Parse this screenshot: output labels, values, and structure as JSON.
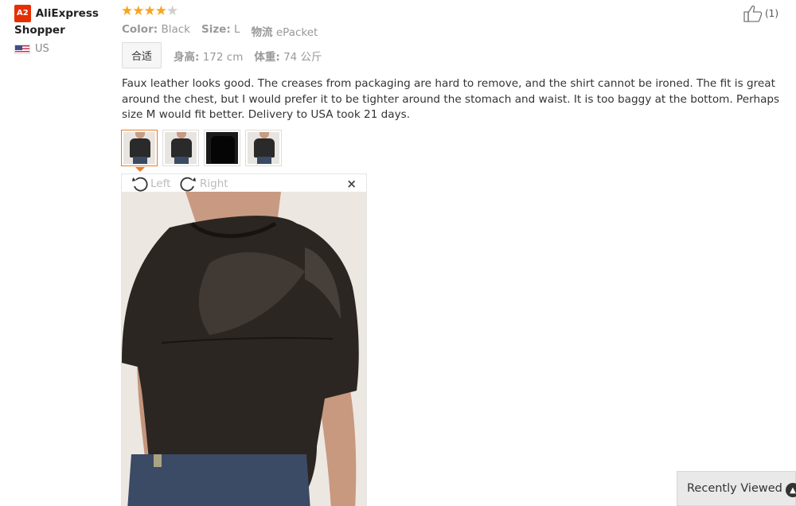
{
  "reviewer": {
    "badge": "A2",
    "name_line1": "AliExpress",
    "name_line2": "Shopper",
    "country": "US"
  },
  "rating": {
    "filled": 4,
    "total": 5
  },
  "attributes": {
    "color_key": "Color:",
    "color_val": "Black",
    "size_key": "Size:",
    "size_val": "L",
    "logistics_key": "物流",
    "logistics_val": "ePacket"
  },
  "fit": {
    "tag": "合适",
    "height_key": "身高:",
    "height_val": "172 cm",
    "weight_key": "体重:",
    "weight_val": "74 公斤"
  },
  "like": {
    "count": "(1)"
  },
  "review_text": "Faux leather looks good. The creases from packaging are hard to remove, and the shirt cannot be ironed. The fit is great around the chest, but I would prefer it to be tighter around the stomach and waist. It is too baggy at the bottom. Perhaps size M would fit better. Delivery to USA took 21 days.",
  "preview": {
    "rotate_left": "Left",
    "rotate_right": "Right",
    "close": "×"
  },
  "recently_viewed": {
    "label": "Recently Viewed"
  },
  "colors": {
    "star": "#f5a623",
    "badge": "#e62e04",
    "active_thumb": "#e87c2a"
  }
}
